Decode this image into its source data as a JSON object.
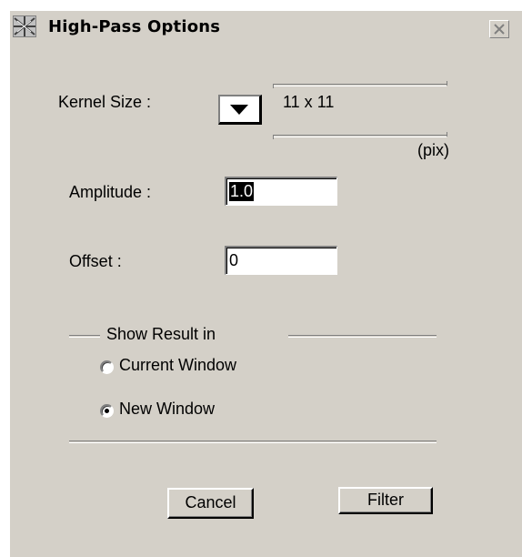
{
  "window": {
    "title": "High-Pass Options",
    "app_icon": "app-icon",
    "close_icon": "close-icon"
  },
  "kernel_size": {
    "label": "Kernel Size :",
    "value": "11 x 11",
    "unit": "(pix)",
    "dropdown_icon": "triangle-down-icon"
  },
  "amplitude": {
    "label": "Amplitude :",
    "value": "1.0"
  },
  "offset": {
    "label": "Offset :",
    "value": "0"
  },
  "show_result": {
    "group_label": "Show Result in",
    "options": [
      {
        "label": "Current Window",
        "selected": false
      },
      {
        "label": "New Window",
        "selected": true
      }
    ]
  },
  "buttons": {
    "cancel": "Cancel",
    "filter": "Filter"
  }
}
